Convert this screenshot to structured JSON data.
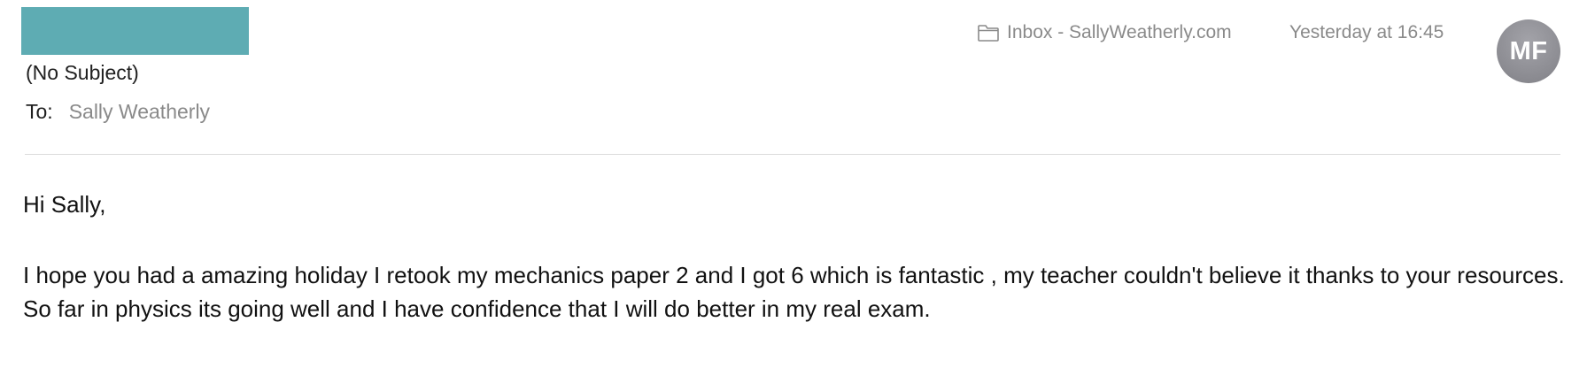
{
  "message": {
    "subject": "(No Subject)",
    "to_label": "To:",
    "to_value": "Sally Weatherly",
    "mailbox": "Inbox - SallyWeatherly.com",
    "timestamp": "Yesterday at 16:45",
    "avatar_initials": "MF",
    "greeting": "Hi Sally,",
    "body": "I hope you had a amazing holiday I retook my mechanics paper 2 and I got 6 which is fantastic , my teacher couldn't believe it thanks to your resources. So far in physics its going well and I have confidence that I will do better in my real exam."
  },
  "icons": {
    "mailbox": "folder-icon"
  },
  "colors": {
    "redaction": "#5eacb3",
    "avatar": "#8b8b91",
    "muted_text": "#8a8a8a"
  }
}
